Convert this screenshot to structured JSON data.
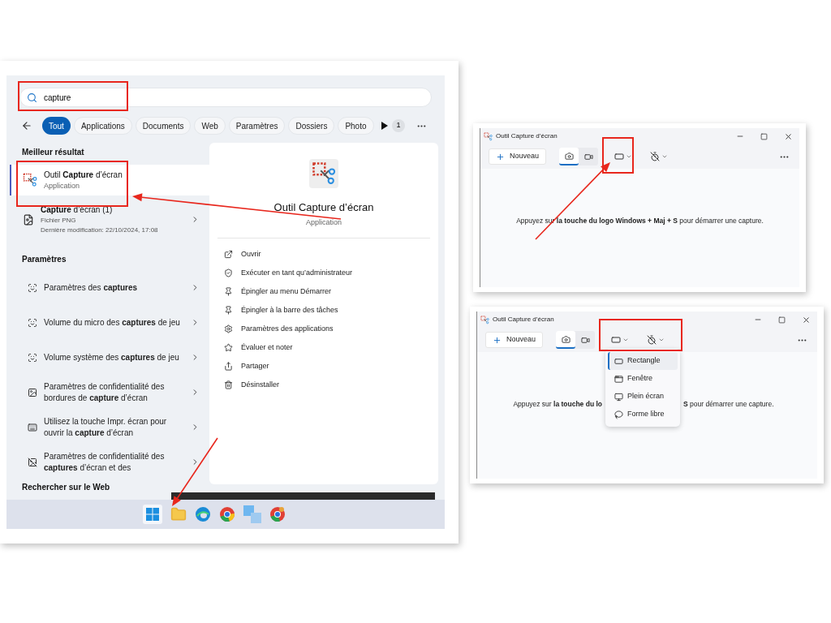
{
  "search": {
    "query": "capture"
  },
  "filters": [
    {
      "label": "Tout",
      "selected": true
    },
    {
      "label": "Applications",
      "selected": false
    },
    {
      "label": "Documents",
      "selected": false
    },
    {
      "label": "Web",
      "selected": false
    },
    {
      "label": "Paramètres",
      "selected": false
    },
    {
      "label": "Dossiers",
      "selected": false
    },
    {
      "label": "Photo",
      "selected": false
    }
  ],
  "result_count": "1",
  "best_result": {
    "heading": "Meilleur résultat",
    "title": "Outil **Capture** d’écran",
    "subtitle": "Application",
    "selected": true
  },
  "file_result": {
    "title": "**Capture** d’écran (1)",
    "type": "Fichier PNG",
    "modified": "Dernière modification: 22/10/2024, 17:08"
  },
  "settings": {
    "heading": "Paramètres",
    "items": [
      {
        "kind": "capture",
        "text": "Paramètres des **captures**"
      },
      {
        "kind": "capture",
        "text": "Volume du micro des **captures** de jeu"
      },
      {
        "kind": "capture",
        "text": "Volume système des **captures** de jeu"
      },
      {
        "kind": "image",
        "text": "Paramètres de confidentialité des bordures de **capture** d’écran"
      },
      {
        "kind": "keyboard",
        "text": "Utilisez la touche Impr. écran pour ouvrir la **capture** d’écran"
      },
      {
        "kind": "privacy",
        "text": "Paramètres de confidentialité des **captures** d’écran et des"
      }
    ]
  },
  "web_heading": "Rechercher sur le Web",
  "preview": {
    "title": "Outil Capture d’écran",
    "subtitle": "Application",
    "actions": [
      {
        "kind": "open",
        "label": "Ouvrir"
      },
      {
        "kind": "admin",
        "label": "Exécuter en tant qu’administrateur"
      },
      {
        "kind": "pin",
        "label": "Épingler au menu Démarrer"
      },
      {
        "kind": "pin",
        "label": "Épingler à la barre des tâches"
      },
      {
        "kind": "settings",
        "label": "Paramètres des applications"
      },
      {
        "kind": "rate",
        "label": "Évaluer et noter"
      },
      {
        "kind": "share",
        "label": "Partager"
      },
      {
        "kind": "uninstall",
        "label": "Désinstaller"
      }
    ]
  },
  "snip_windows": [
    {
      "title": "Outil Capture d’écran",
      "new_button": "Nouveau",
      "modes": [
        {
          "kind": "photo",
          "selected": true
        },
        {
          "kind": "video",
          "selected": false
        }
      ],
      "hint": [
        "Appuyez sur **la touche du logo Windows + Maj + S** pour démarrer une capture."
      ]
    },
    {
      "title": "Outil Capture d’écran",
      "new_button": "Nouveau",
      "modes": [
        {
          "kind": "photo",
          "selected": true
        },
        {
          "kind": "video",
          "selected": false
        }
      ],
      "hint": [
        "Appuyez sur **la touche du lo**",
        "**S** pour démarrer une capture."
      ],
      "menu": [
        {
          "kind": "rectangle",
          "label": "Rectangle",
          "selected": true
        },
        {
          "kind": "window",
          "label": "Fenêtre",
          "selected": false
        },
        {
          "kind": "fullscreen",
          "label": "Plein écran",
          "selected": false
        },
        {
          "kind": "freeform",
          "label": "Forme libre",
          "selected": false
        }
      ]
    }
  ]
}
